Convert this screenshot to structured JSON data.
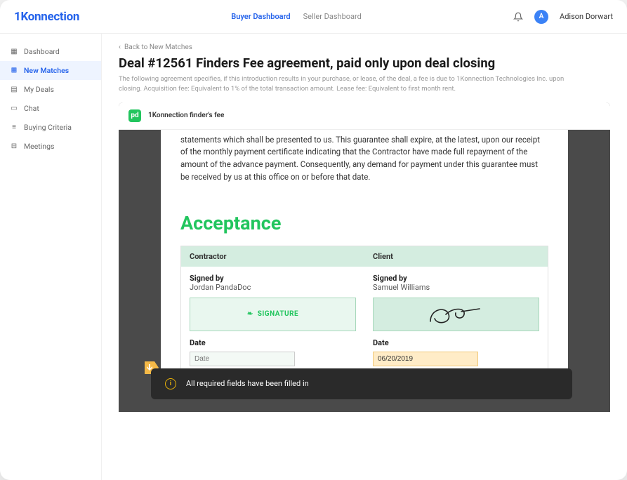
{
  "brand": "1Konnection",
  "tabs": {
    "buyer": "Buyer Dashboard",
    "seller": "Seller Dashboard"
  },
  "user": {
    "initial": "A",
    "name": "Adison Dorwart"
  },
  "sidebar": {
    "items": [
      {
        "label": "Dashboard"
      },
      {
        "label": "New Matches"
      },
      {
        "label": "My Deals"
      },
      {
        "label": "Chat"
      },
      {
        "label": "Buying Criteria"
      },
      {
        "label": "Meetings"
      }
    ]
  },
  "back": "Back to New Matches",
  "title": "Deal #12561 Finders Fee agreement, paid only upon deal closing",
  "subtitle": "The following agreement specifies, if this introduction results in your purchase, or lease, of the deal, a fee is due to 1Konnection Technologies Inc. upon closing. Acquisition fee: Equivalent to 1% of the total transaction amount. Lease fee: Equivalent to first month rent.",
  "doc": {
    "header": "1Konnection finder's fee",
    "paragraph": "statements which shall be presented to us. This guarantee shall expire, at the latest, upon our receipt of the monthly payment certificate indicating that the Contractor have made full repayment of the amount of the advance payment. Consequently, any demand for payment under this guarantee must be received by us at this office on or before that date.",
    "acceptance": "Acceptance",
    "col1": "Contractor",
    "col2": "Client",
    "signed_by": "Signed by",
    "contractor_name": "Jordan PandaDoc",
    "client_name": "Samuel  Williams",
    "signature_label": "SIGNATURE",
    "date_label": "Date",
    "date_placeholder": "Date",
    "client_date": "06/20/2019"
  },
  "toast": "All required fields have been filled in"
}
